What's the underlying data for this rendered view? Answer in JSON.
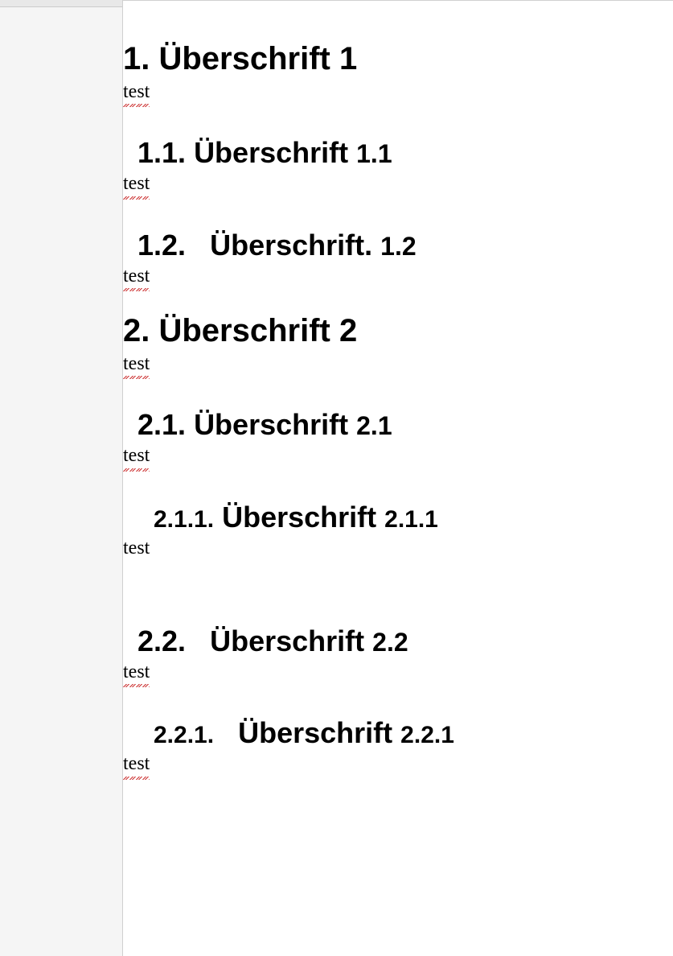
{
  "sections": [
    {
      "level": 1,
      "number": "1.",
      "title": "Überschrift",
      "suffix": "1",
      "body": "test",
      "spellcheck": true
    },
    {
      "level": 2,
      "number": "1.1.",
      "title": "Überschrift",
      "suffix": "1.1",
      "body": "test",
      "spellcheck": true
    },
    {
      "level": 2,
      "number": "1.2.",
      "title": "Überschrift.",
      "suffix": "1.2",
      "body": "test",
      "spellcheck": true
    },
    {
      "level": 1,
      "number": "2.",
      "title": "Überschrift",
      "suffix": "2",
      "body": "test",
      "spellcheck": true
    },
    {
      "level": 2,
      "number": "2.1.",
      "title": "Überschrift",
      "suffix": "2.1",
      "body": "test",
      "spellcheck": true
    },
    {
      "level": 3,
      "number": "2.1.1.",
      "title": "Überschrift",
      "suffix": "2.1.1",
      "body": "test",
      "spellcheck": false,
      "gapAfter": true
    },
    {
      "level": 2,
      "number": "2.2.",
      "title": "Überschrift",
      "suffix": "2.2",
      "body": "test",
      "spellcheck": true
    },
    {
      "level": 3,
      "number": "2.2.1.",
      "title": "Überschrift",
      "suffix": "2.2.1",
      "body": "test",
      "spellcheck": true
    }
  ]
}
